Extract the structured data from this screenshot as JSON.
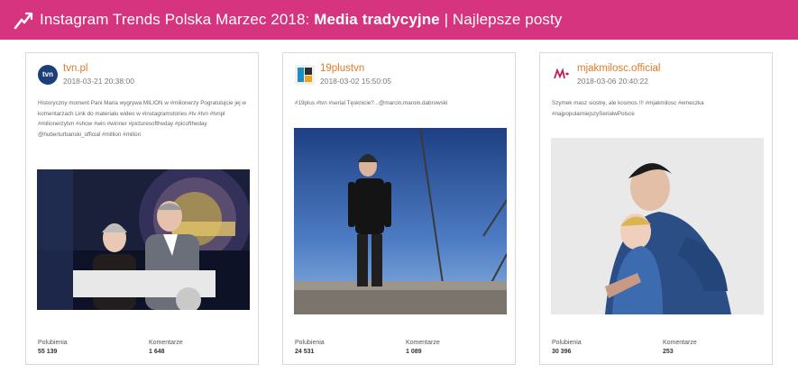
{
  "header": {
    "title_prefix": "Instagram Trends Polska Marzec 2018:",
    "title_bold": "Media tradycyjne",
    "title_suffix": "| Najlepsze posty"
  },
  "stat_labels": {
    "likes": "Polubienia",
    "comments": "Komentarze"
  },
  "posts": [
    {
      "user": "tvn.pl",
      "date": "2018-03-21 20:38:00",
      "caption": "Historyczny moment Pani Maria wygrywa MILION w #milionerzy Pogratulujcie jej w komentarzach  Link do materiału wideo w #instagramstories #tv #tvn #tvnpl #milionerzytvn #show #win #winner #picturesoftheday #picoftheday @huberturbanski_official #million #milion",
      "likes": "55 139",
      "comments": "1 648",
      "avatar_text": "tvn"
    },
    {
      "user": "19plustvn",
      "date": "2018-03-02 15:50:05",
      "caption": "#19plus #tvn #serial Tęsknicie?...@marcin.maroin.dabrowski",
      "likes": "24 531",
      "comments": "1 089"
    },
    {
      "user": "mjakmilosc.official",
      "date": "2018-03-06 20:40:22",
      "caption": "Szymek masz siostrę, ale kosmos !!! #mjakmilosc #emeczka #najpopularniejszySerialwPolsce",
      "likes": "30 396",
      "comments": "253"
    }
  ]
}
